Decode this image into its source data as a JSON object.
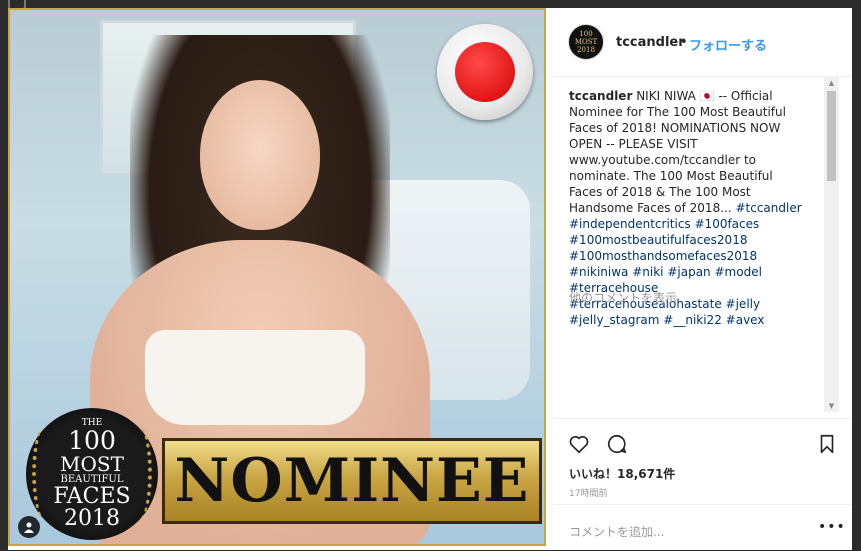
{
  "post": {
    "badge": {
      "the": "THE",
      "hundred": "100",
      "most": "MOST",
      "beautiful": "BEAUTIFUL",
      "faces": "FACES",
      "year": "2018"
    },
    "banner_text": "NOMINEE"
  },
  "header": {
    "avatar_text": "100 MOST 2018",
    "username": "tccandler",
    "separator": "•",
    "follow_label": "フォローする"
  },
  "caption": {
    "username": "tccandler",
    "text": "NIKI NIWA 🇯🇵 -- Official Nominee for The 100 Most Beautiful Faces of 2018! NOMINATIONS NOW OPEN -- PLEASE VISIT www.youtube.com/tccandler to nominate. The 100 Most Beautiful Faces of 2018 & The 100 Most Handsome Faces of 2018... ",
    "hashtags": [
      "#tccandler",
      "#independentcritics",
      "#100faces",
      "#100mostbeautifulfaces2018",
      "#100mosthandsomefaces2018",
      "#nikiniwa",
      "#niki",
      "#japan",
      "#model",
      "#terracehouse",
      "#terracehousealohastate",
      "#jelly",
      "#jelly_stagram",
      "#__niki22",
      "#avex"
    ]
  },
  "comments": {
    "view_more": "他のコメントを表示",
    "add_placeholder": "コメントを追加...",
    "more_label": "•••"
  },
  "stats": {
    "likes_label": "いいね！18,671件",
    "time_ago": "17時間前"
  },
  "icons": {
    "like": "heart-icon",
    "comment": "speech-bubble-icon",
    "save": "bookmark-icon",
    "tag": "person-tag-icon"
  },
  "colors": {
    "link": "#3897f0",
    "hashtag": "#003569",
    "text": "#262626",
    "muted": "#999999",
    "border": "#efefef"
  }
}
